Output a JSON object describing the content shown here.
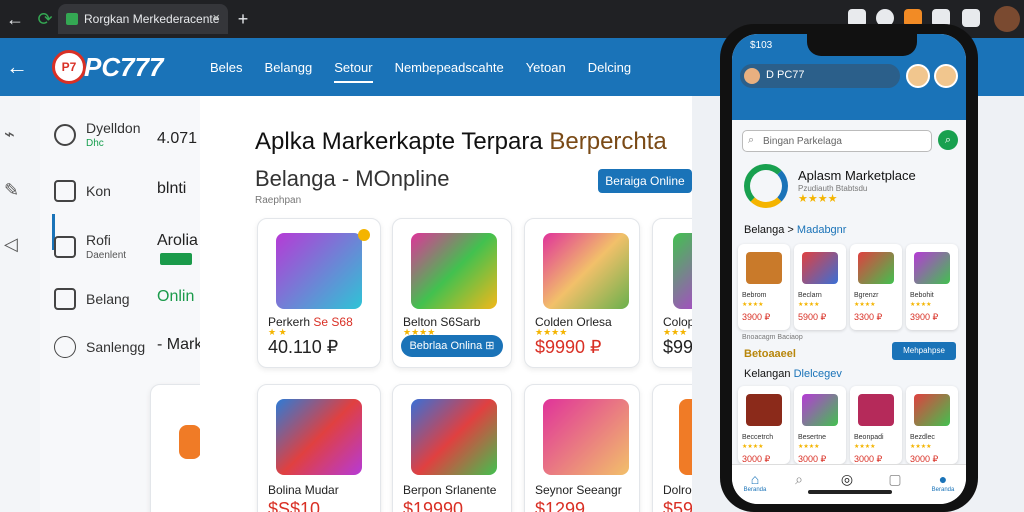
{
  "browser": {
    "tab_title": "Rorgkan Merkederacente",
    "back_icon": "←",
    "reload_icon": "⟳",
    "close_icon": "×",
    "new_tab_icon": "+"
  },
  "header": {
    "logo_badge": "P7",
    "logo_text": "PC777",
    "back_icon": "←",
    "nav": [
      "Beles",
      "Belangg",
      "Setour",
      "Nembepeadscahte",
      "Yetoan",
      "Delcing"
    ],
    "active_index": 2
  },
  "sidebar": {
    "items": [
      {
        "label": "Dyelldon",
        "sub": "Dhc",
        "value": "4.071"
      },
      {
        "label": "Kon",
        "value": "blnti"
      },
      {
        "label": "Rofi",
        "sub": "Daenlent",
        "value": "Arolia"
      },
      {
        "label": "Belang",
        "value": "Onlin"
      },
      {
        "label": "Sanlengg",
        "value": "- Mark"
      }
    ]
  },
  "main": {
    "title_part1": "Aplka Markerkapte Terpara",
    "title_part2": "Berperchta",
    "subtitle": "Belanga - MOnpline",
    "breadcrumb": "Raephpan",
    "cta": "Beraiga Online",
    "cards": [
      {
        "title": "Perkerh",
        "extra": "Se S68",
        "price": "40.110 ₽"
      },
      {
        "title": "Belton S6Sarb",
        "pill": "Bebrlaa Onlina ⊞"
      },
      {
        "title": "Colden Orlesa",
        "price": "$9990 ₽"
      },
      {
        "title": "Colop",
        "price": "$999"
      },
      {
        "title": "Bolina Mudar",
        "price": "$S$10"
      },
      {
        "title": "Berpon Srlanente",
        "price": "$19990"
      },
      {
        "title": "Seynor Seeangr",
        "price": "$1299"
      },
      {
        "title": "Dolros",
        "price": "$59"
      }
    ]
  },
  "phone": {
    "status_time": "$103",
    "user_name": "D PC77",
    "search_placeholder": "Bingan Parkelaga",
    "app_title": "Aplasm Marketplace",
    "app_sub": "Pzudiauth Btabtsdu",
    "app_stars": "★★★★",
    "section1": "Belanga >",
    "section1_hl": "Madabgnr",
    "small_note": "Bnoacagm Baciaop",
    "yellow_label": "Betoaaeel",
    "btn": "Mehpahpse",
    "section2": "Kelangan",
    "section2_hl": "Dlelcegev",
    "row1": [
      {
        "title": "Bebrom",
        "price": "3900 ₽"
      },
      {
        "title": "Beclarn",
        "price": "5900 ₽"
      },
      {
        "title": "Bgrenzr",
        "price": "3300 ₽"
      },
      {
        "title": "Bebohit",
        "price": "3900 ₽"
      }
    ],
    "row2": [
      {
        "title": "Beccetrch",
        "price": "3000 ₽"
      },
      {
        "title": "Besertne",
        "price": "3000 ₽"
      },
      {
        "title": "Beonpadi",
        "price": "3000 ₽"
      },
      {
        "title": "Bezdlec",
        "price": "3000 ₽"
      }
    ],
    "tabs": [
      "Beranda",
      "",
      "",
      "",
      "Beranda"
    ]
  },
  "colors": {
    "brand_blue": "#1a73b8",
    "accent_green": "#18a04f",
    "price_red": "#d93025",
    "star_yellow": "#f4b400"
  }
}
